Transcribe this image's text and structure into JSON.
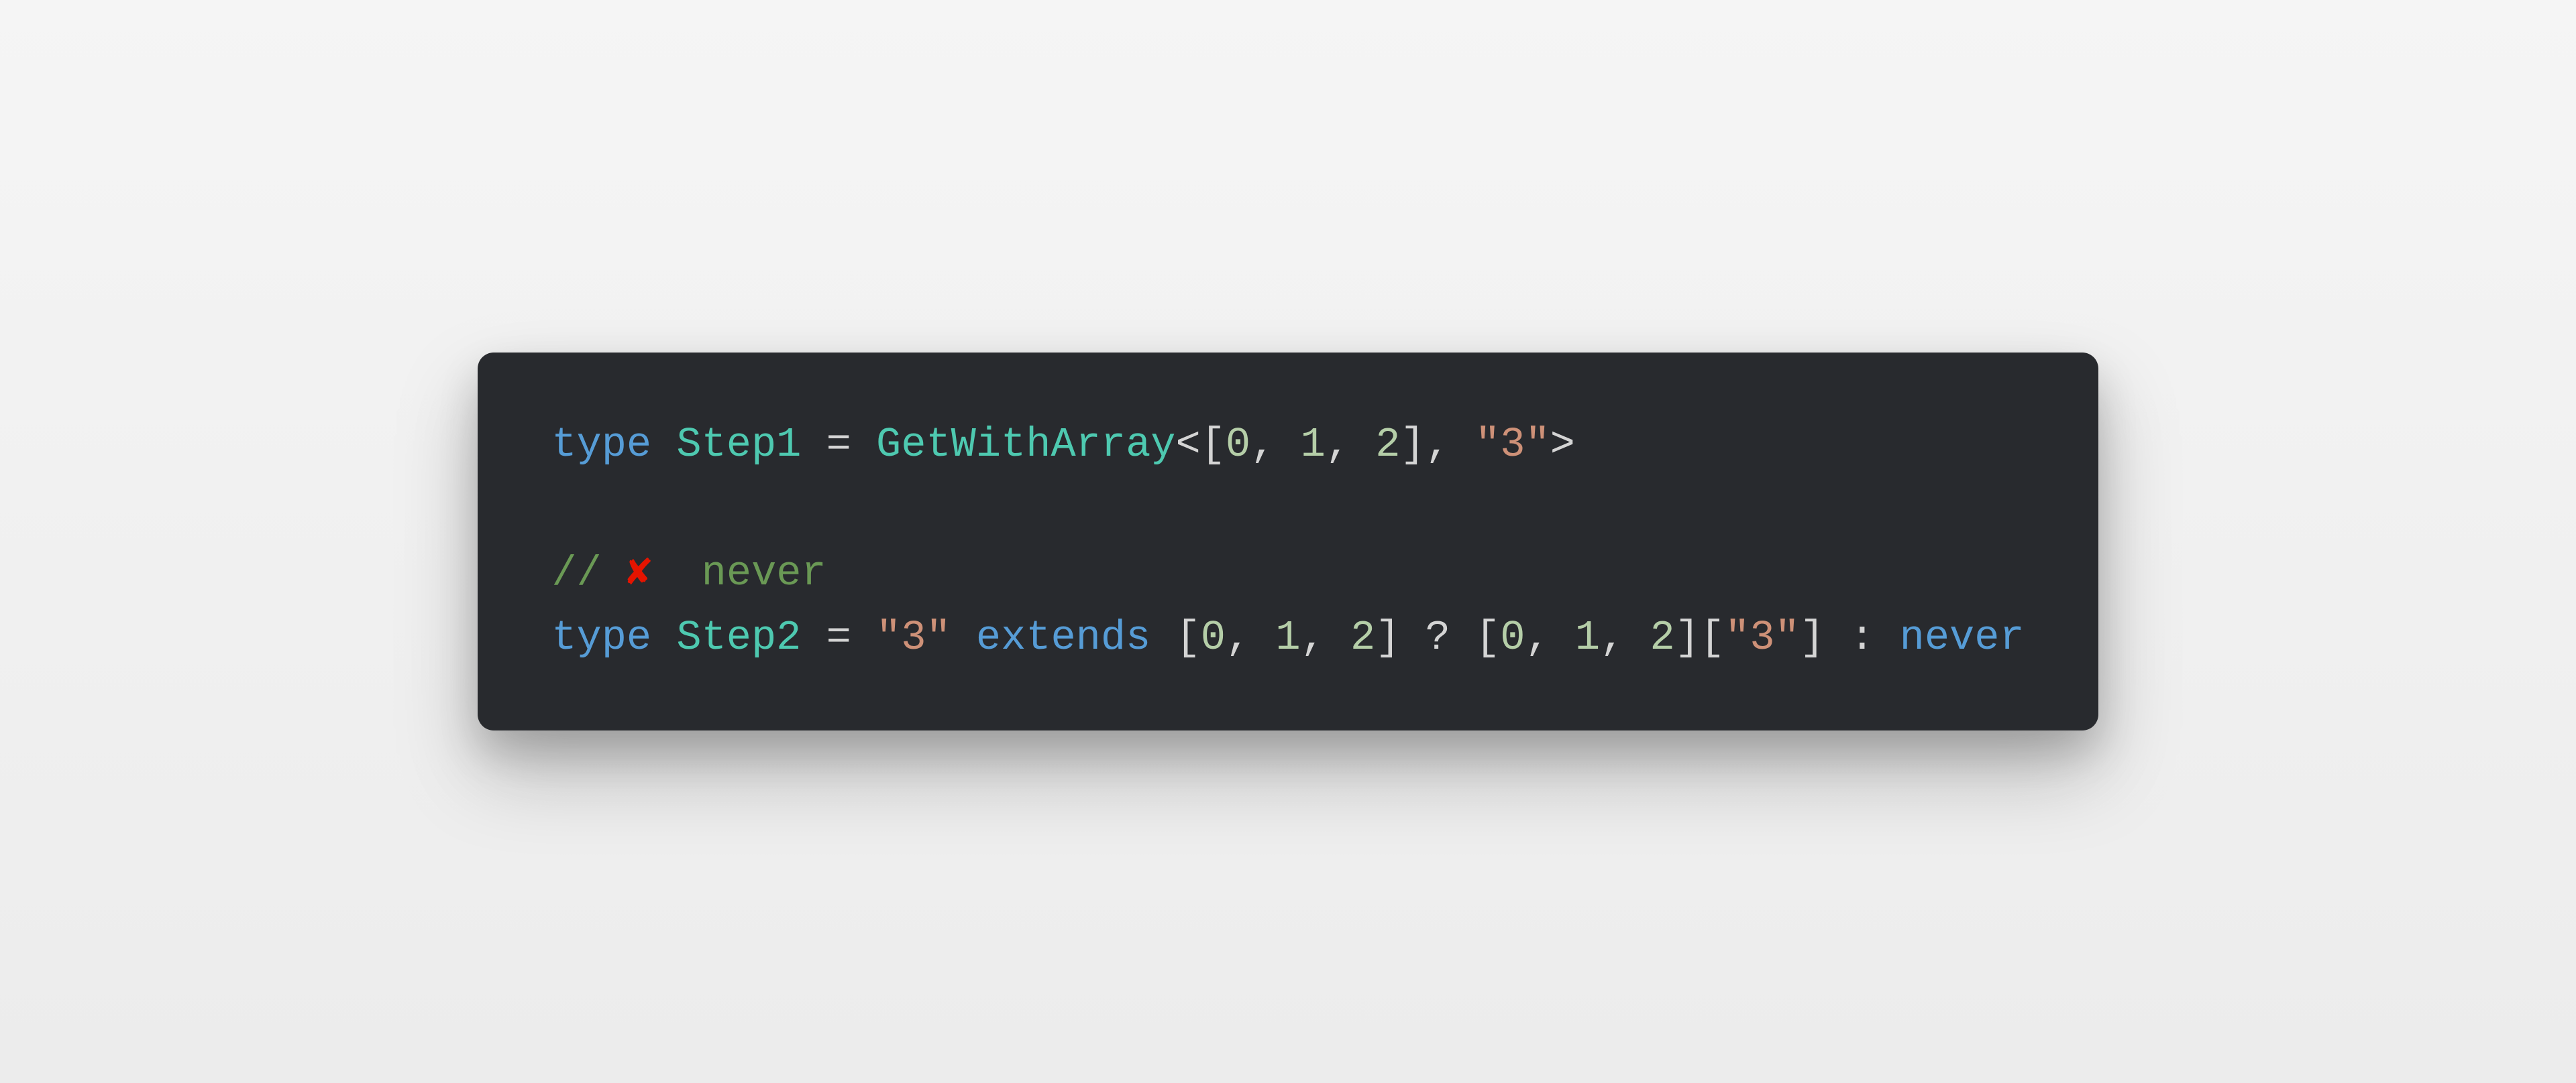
{
  "code": {
    "lines": [
      {
        "tokens": [
          {
            "cls": "tok-keyword",
            "text": "type"
          },
          {
            "cls": "tok-punct",
            "text": " "
          },
          {
            "cls": "tok-type",
            "text": "Step1"
          },
          {
            "cls": "tok-punct",
            "text": " = "
          },
          {
            "cls": "tok-type",
            "text": "GetWithArray"
          },
          {
            "cls": "tok-punct",
            "text": "<["
          },
          {
            "cls": "tok-number",
            "text": "0"
          },
          {
            "cls": "tok-punct",
            "text": ", "
          },
          {
            "cls": "tok-number",
            "text": "1"
          },
          {
            "cls": "tok-punct",
            "text": ", "
          },
          {
            "cls": "tok-number",
            "text": "2"
          },
          {
            "cls": "tok-punct",
            "text": "], "
          },
          {
            "cls": "tok-string",
            "text": "\"3\""
          },
          {
            "cls": "tok-punct",
            "text": ">"
          }
        ]
      },
      {
        "tokens": []
      },
      {
        "tokens": [
          {
            "cls": "tok-comment",
            "text": "// "
          },
          {
            "cls": "tok-emoji-cross",
            "text": "✘"
          },
          {
            "cls": "tok-comment",
            "text": "  never"
          }
        ]
      },
      {
        "tokens": [
          {
            "cls": "tok-keyword",
            "text": "type"
          },
          {
            "cls": "tok-punct",
            "text": " "
          },
          {
            "cls": "tok-type",
            "text": "Step2"
          },
          {
            "cls": "tok-punct",
            "text": " = "
          },
          {
            "cls": "tok-string",
            "text": "\"3\""
          },
          {
            "cls": "tok-punct",
            "text": " "
          },
          {
            "cls": "tok-keyword",
            "text": "extends"
          },
          {
            "cls": "tok-punct",
            "text": " ["
          },
          {
            "cls": "tok-number",
            "text": "0"
          },
          {
            "cls": "tok-punct",
            "text": ", "
          },
          {
            "cls": "tok-number",
            "text": "1"
          },
          {
            "cls": "tok-punct",
            "text": ", "
          },
          {
            "cls": "tok-number",
            "text": "2"
          },
          {
            "cls": "tok-punct",
            "text": "] ? ["
          },
          {
            "cls": "tok-number",
            "text": "0"
          },
          {
            "cls": "tok-punct",
            "text": ", "
          },
          {
            "cls": "tok-number",
            "text": "1"
          },
          {
            "cls": "tok-punct",
            "text": ", "
          },
          {
            "cls": "tok-number",
            "text": "2"
          },
          {
            "cls": "tok-punct",
            "text": "]["
          },
          {
            "cls": "tok-string",
            "text": "\"3\""
          },
          {
            "cls": "tok-punct",
            "text": "] : "
          },
          {
            "cls": "tok-keyword",
            "text": "never"
          }
        ]
      }
    ]
  }
}
